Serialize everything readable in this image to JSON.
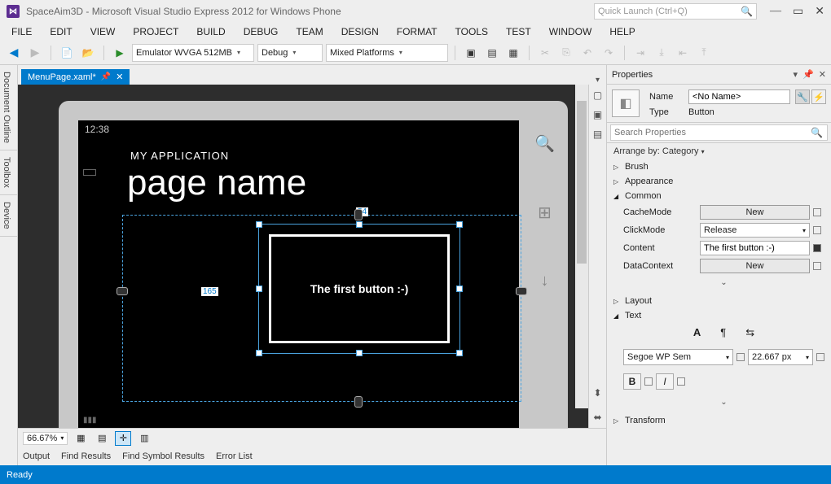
{
  "window": {
    "title": "SpaceAim3D - Microsoft Visual Studio Express 2012 for Windows Phone",
    "quick_launch_placeholder": "Quick Launch (Ctrl+Q)"
  },
  "menu": [
    "FILE",
    "EDIT",
    "VIEW",
    "PROJECT",
    "BUILD",
    "DEBUG",
    "TEAM",
    "DESIGN",
    "FORMAT",
    "TOOLS",
    "TEST",
    "WINDOW",
    "HELP"
  ],
  "toolbar": {
    "emulator": "Emulator WVGA 512MB",
    "config": "Debug",
    "platform": "Mixed Platforms"
  },
  "side_tabs": [
    "Document Outline",
    "Toolbox",
    "Device"
  ],
  "doc_tab": {
    "name": "MenuPage.xaml*",
    "pinned": true
  },
  "designer": {
    "time": "12:38",
    "app_title": "MY APPLICATION",
    "page_name": "page name",
    "button_text": "The first button :-)",
    "margin_left": "165",
    "margin_top": "54",
    "zoom": "66.67%"
  },
  "bottom_tabs": [
    "Output",
    "Find Results",
    "Find Symbol Results",
    "Error List"
  ],
  "properties": {
    "panel_title": "Properties",
    "name_label": "Name",
    "name_value": "<No Name>",
    "type_label": "Type",
    "type_value": "Button",
    "search_placeholder": "Search Properties",
    "arrange_by": "Arrange by: Category",
    "categories": {
      "brush": "Brush",
      "appearance": "Appearance",
      "common": "Common",
      "layout": "Layout",
      "text": "Text",
      "transform": "Transform"
    },
    "common": {
      "cache_mode_label": "CacheMode",
      "cache_mode_btn": "New",
      "click_mode_label": "ClickMode",
      "click_mode_value": "Release",
      "content_label": "Content",
      "content_value": "The first button :-)",
      "data_context_label": "DataContext",
      "data_context_btn": "New"
    },
    "text": {
      "font_family": "Segoe WP Sem",
      "font_size": "22.667 px",
      "bold": "B",
      "italic": "I"
    }
  },
  "status": "Ready"
}
